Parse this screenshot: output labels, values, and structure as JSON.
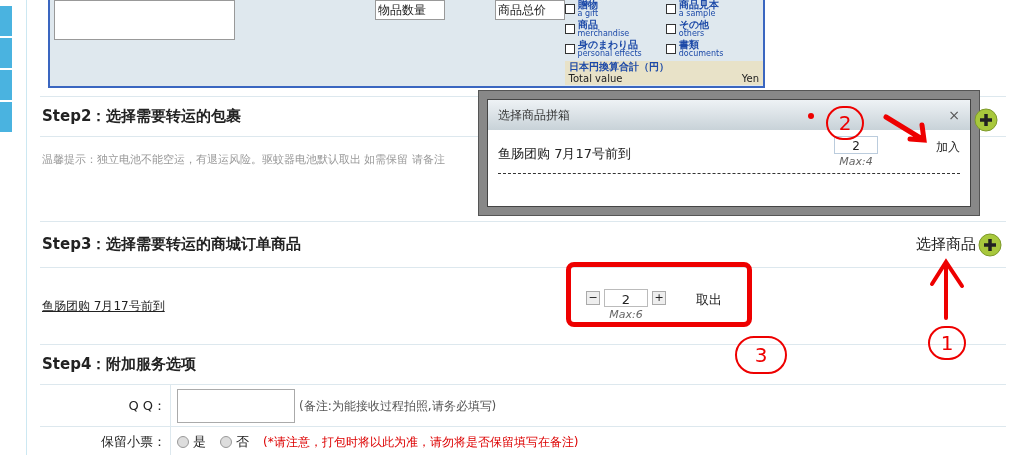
{
  "form_document": {
    "fields": [
      "物品数量",
      "商品总价"
    ],
    "categories": [
      {
        "ja": "贈物",
        "en": "a gift",
        "checked": false
      },
      {
        "ja": "商品見本",
        "en": "a sample",
        "checked": false
      },
      {
        "ja": "商品",
        "en": "merchandise",
        "checked": false
      },
      {
        "ja": "その他",
        "en": "others",
        "checked": false
      },
      {
        "ja": "身のまわり品",
        "en": "personal effects",
        "checked": false
      },
      {
        "ja": "書類",
        "en": "documents",
        "checked": false
      }
    ],
    "total_label": "日本円換算合計（円）",
    "total_en": "Total value",
    "total_unit": "Yen"
  },
  "step2": {
    "title": "Step2：选择需要转运的包裹",
    "hint": "温馨提示：独立电池不能空运，有退运风险。驱蚊器电池默认取出 如需保留 请备注"
  },
  "step3": {
    "title": "Step3：选择需要转运的商城订单商品",
    "add_button": "选择商品",
    "items": [
      {
        "name": "鱼肠团购 7月17号前到",
        "minus": "−",
        "quantity": "2",
        "plus": "+",
        "max": "Max:6",
        "remove": "取出"
      }
    ]
  },
  "step4": {
    "title": "Step4：附加服务选项",
    "qq_label": "Q Q：",
    "qq_note": "(备注:为能接收过程拍照,请务必填写)",
    "ticket_label": "保留小票：",
    "ticket_options": [
      {
        "label": "是",
        "selected": false
      },
      {
        "label": "否",
        "selected": false
      }
    ],
    "ticket_warning": "(*请注意，打包时将以此为准，请勿将是否保留填写在备注)"
  },
  "dialog": {
    "title": "选择商品拼箱",
    "close": "×",
    "items": [
      {
        "name": "鱼肠团购 7月17号前到",
        "quantity": "2",
        "max": "Max:4",
        "add": "加入"
      }
    ]
  },
  "annotations": [
    "1",
    "2",
    "3"
  ]
}
